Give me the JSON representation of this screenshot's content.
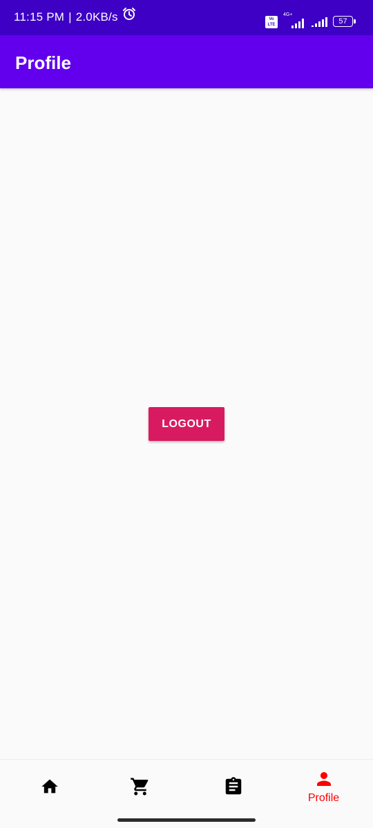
{
  "status_bar": {
    "time": "11:15 PM",
    "separator": "|",
    "speed": "2.0KB/s",
    "volte_top": "Vo",
    "volte_bottom": "LTE",
    "network_type": "4G+",
    "battery_level": "57",
    "icons": [
      "alarm-icon",
      "volte-icon",
      "signal-icon",
      "signal-icon",
      "battery-icon"
    ]
  },
  "app_bar": {
    "title": "Profile"
  },
  "main": {
    "logout_label": "LOGOUT"
  },
  "bottom_nav": {
    "items": [
      {
        "icon": "home-icon",
        "label": "",
        "active": false
      },
      {
        "icon": "cart-icon",
        "label": "",
        "active": false
      },
      {
        "icon": "clipboard-icon",
        "label": "",
        "active": false
      },
      {
        "icon": "person-icon",
        "label": "Profile",
        "active": true
      }
    ]
  },
  "colors": {
    "status_bar": "#3d00c4",
    "app_bar": "#6200ee",
    "button": "#d81b60",
    "active_nav": "#ff0000",
    "background": "#fafafa"
  }
}
